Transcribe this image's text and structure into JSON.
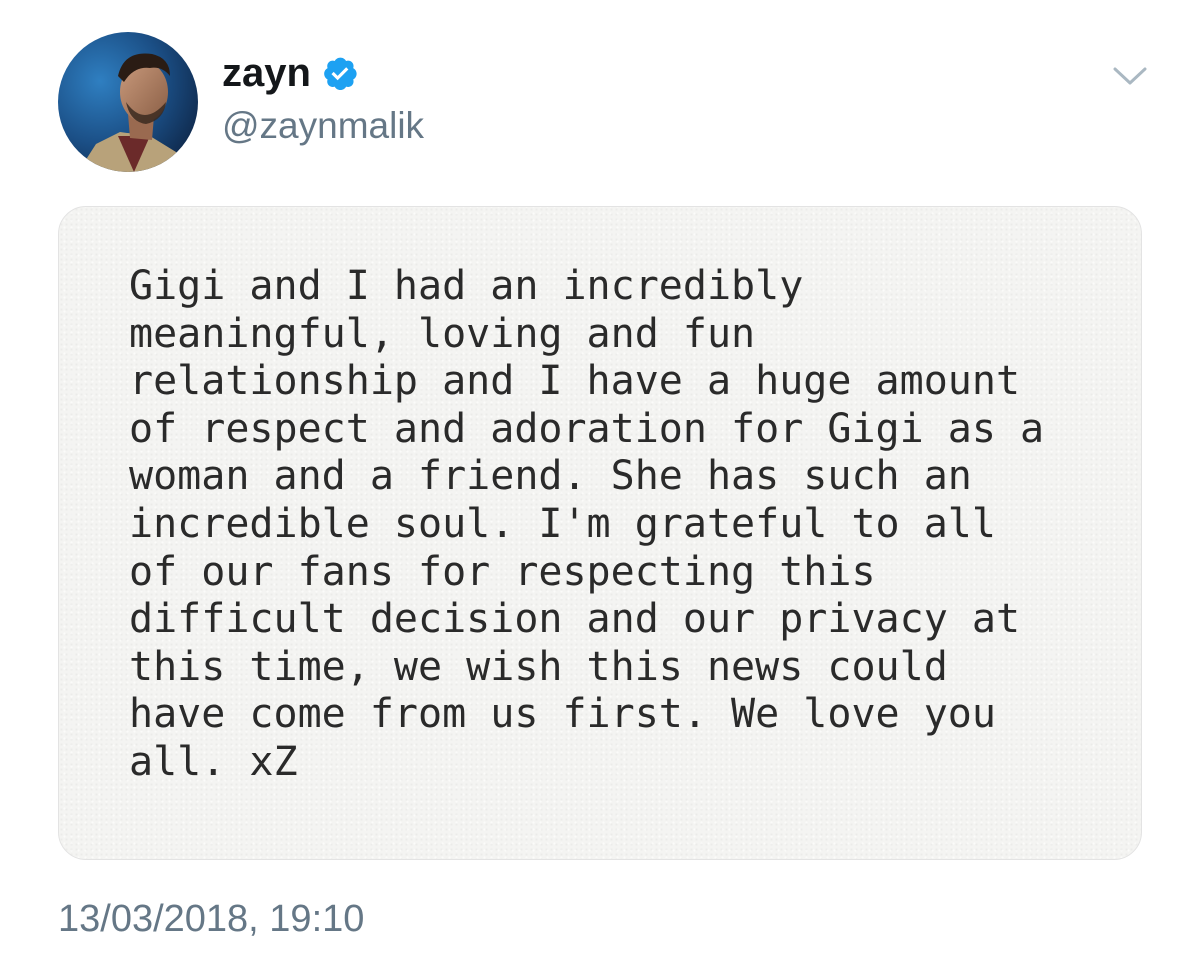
{
  "tweet": {
    "author": {
      "display_name": "zayn",
      "handle": "@zaynmalik",
      "verified": true
    },
    "note_lines": [
      "Gigi and I had an incredibly",
      "meaningful, loving and fun",
      "relationship and I have a huge amount",
      "of respect and adoration for Gigi as a",
      "woman and a friend. She has such an",
      "incredible soul. I'm grateful to all",
      "of our fans for respecting this",
      "difficult decision and our privacy at",
      "this time, we wish this news could",
      "have come from us first. We love you",
      "all. xZ"
    ],
    "timestamp": "13/03/2018, 19:10"
  },
  "icons": {
    "verified": "verified-badge-icon",
    "caret": "chevron-down-icon"
  },
  "colors": {
    "verified_blue": "#1da1f2",
    "secondary_text": "#657786",
    "primary_text": "#14171a"
  }
}
